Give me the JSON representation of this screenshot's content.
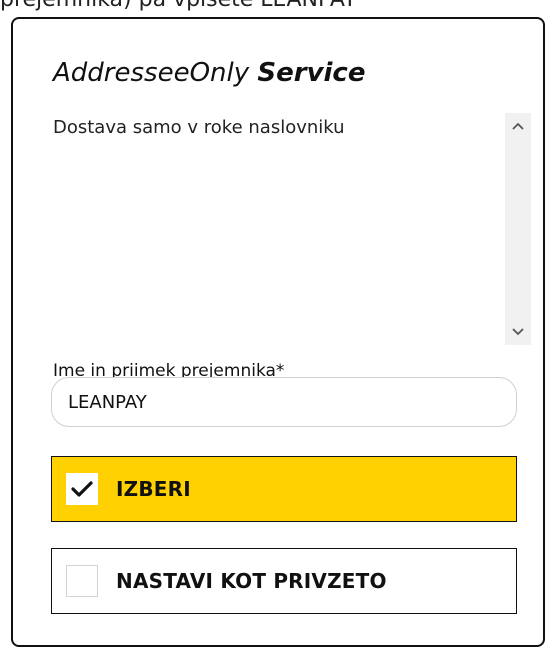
{
  "top_text": "prejemnika) pa vpišete LEANPAY",
  "card": {
    "title_regular": "AddresseeOnly",
    "title_bold": "Service",
    "description": "Dostava samo v roke naslovniku",
    "recipient_label": "Ime in priimek prejemnika*",
    "recipient_value": "LEANPAY",
    "options": [
      {
        "label": "IZBERI",
        "checked": true
      },
      {
        "label": "NASTAVI KOT PRIVZETO",
        "checked": false
      }
    ]
  },
  "colors": {
    "accent_yellow": "#ffd100",
    "border_dark": "#111111"
  },
  "icons": {
    "scroll_up": "chevron-up-icon",
    "scroll_down": "chevron-down-icon",
    "checkmark": "checkmark-icon"
  }
}
